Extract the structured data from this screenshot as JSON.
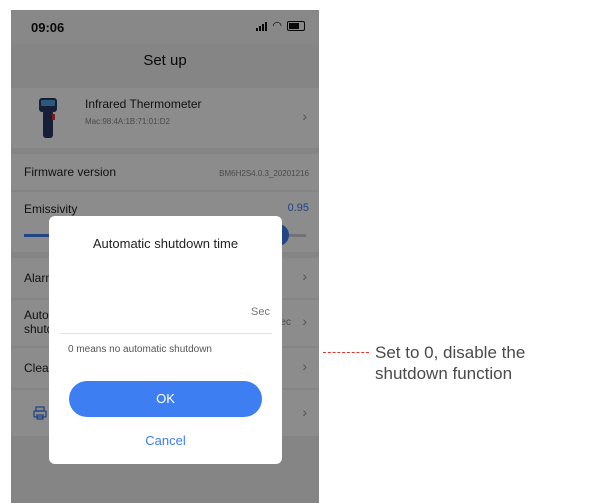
{
  "status": {
    "time": "09:06"
  },
  "nav": {
    "title": "Set up"
  },
  "device": {
    "name": "Infrared Thermometer",
    "mac": "Mac:98:4A:1B:71:01:D2"
  },
  "firmware": {
    "label": "Firmware version",
    "value": "BM6H2S4.0.3_20201216"
  },
  "emissivity": {
    "label": "Emissivity",
    "value": "0.95",
    "level": 0.9
  },
  "rows": [
    {
      "label": "Alarm"
    },
    {
      "label": "Automatic",
      "label2": "shutdown time",
      "value": "Sec"
    },
    {
      "label": "Clear data"
    },
    {
      "label": ""
    }
  ],
  "dialog": {
    "title": "Automatic shutdown time",
    "input_value": "",
    "unit": "Sec",
    "hint": "0 means no automatic shutdown",
    "ok_label": "OK",
    "cancel_label": "Cancel"
  },
  "annotation": {
    "text": "Set to 0, disable the shutdown function"
  },
  "colors": {
    "accent": "#3d7ef2",
    "annotation_line": "#e0342f"
  }
}
